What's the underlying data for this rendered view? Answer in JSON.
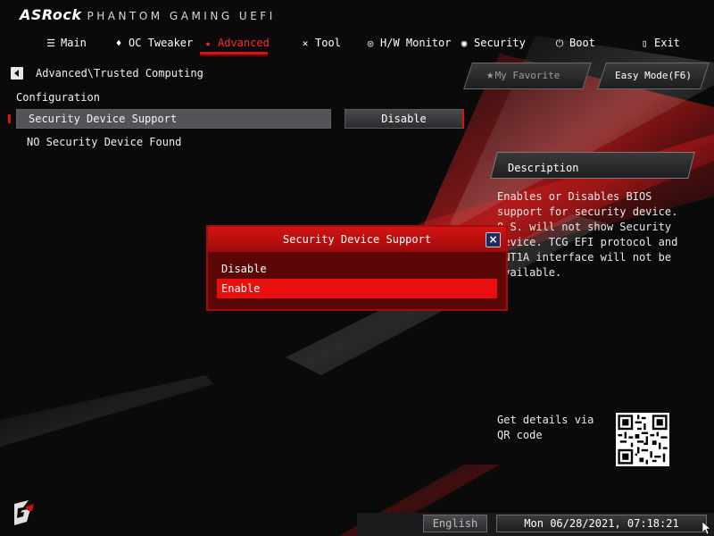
{
  "header": {
    "brand": "ASRock",
    "brand_sub": "PHANTOM GAMING UEFI"
  },
  "nav": {
    "items": [
      {
        "label": "Main",
        "icon": "list-icon"
      },
      {
        "label": "OC Tweaker",
        "icon": "flame-icon"
      },
      {
        "label": "Advanced",
        "icon": "star-icon",
        "active": true
      },
      {
        "label": "Tool",
        "icon": "tools-icon"
      },
      {
        "label": "H/W Monitor",
        "icon": "monitor-icon"
      },
      {
        "label": "Security",
        "icon": "shield-icon"
      },
      {
        "label": "Boot",
        "icon": "power-icon"
      },
      {
        "label": "Exit",
        "icon": "exit-icon"
      }
    ]
  },
  "breadcrumb": "Advanced\\Trusted Computing",
  "buttons": {
    "favorite": "My Favorite",
    "easy_mode": "Easy Mode(F6)"
  },
  "config": {
    "section_title": "Configuration",
    "row_label": "Security Device Support",
    "row_value": "Disable",
    "info": "NO Security Device Found"
  },
  "description": {
    "title": "Description",
    "text": "Enables or Disables BIOS support for security device. O.S. will not show Security Device. TCG EFI protocol and INT1A interface will not be available."
  },
  "modal": {
    "title": "Security Device Support",
    "close": "×",
    "options": [
      "Disable",
      "Enable"
    ],
    "selected": "Enable"
  },
  "qr": {
    "label": "Get details via QR code"
  },
  "footer": {
    "language": "English",
    "datetime": "Mon 06/28/2021, 07:18:21"
  },
  "colors": {
    "accent": "#e01010",
    "modal_bg": "#5c0606",
    "selected_option": "#e80f0f"
  }
}
